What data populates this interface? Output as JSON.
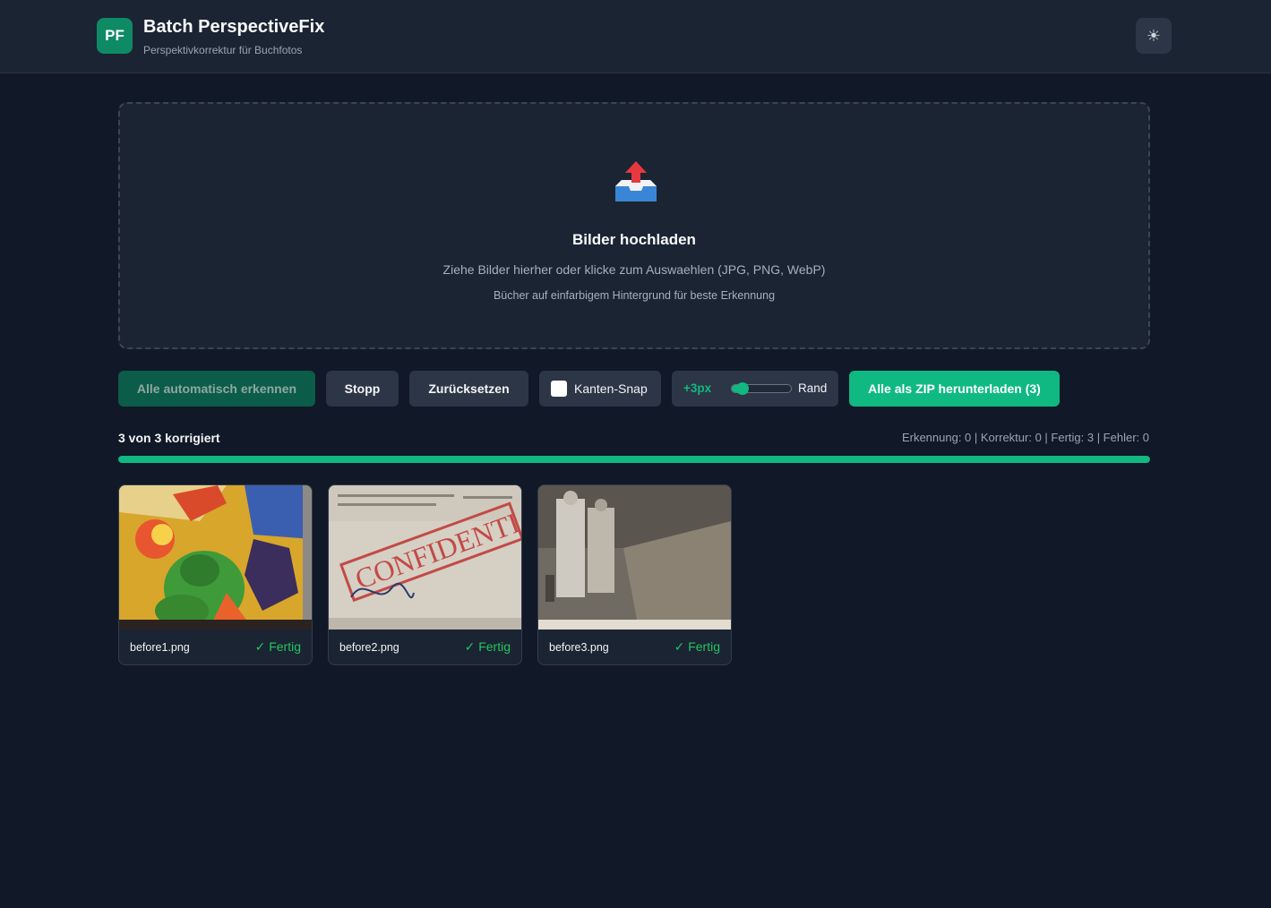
{
  "header": {
    "logo": "PF",
    "title": "Batch PerspectiveFix",
    "subtitle": "Perspektivkorrektur für Buchfotos",
    "theme_icon": "sun-icon",
    "theme_glyph": "☀"
  },
  "upload": {
    "icon": "inbox-upload-icon",
    "title": "Bilder hochladen",
    "hint": "Ziehe Bilder hierher oder klicke zum Auswaehlen (JPG, PNG, WebP)",
    "tip": "Bücher auf einfarbigem Hintergrund für beste Erkennung"
  },
  "toolbar": {
    "detect_label": "Alle automatisch erkennen",
    "stop_label": "Stopp",
    "reset_label": "Zurücksetzen",
    "snap_label": "Kanten-Snap",
    "snap_checked": false,
    "margin_value": "+3px",
    "margin_slider_fraction": 0.18,
    "margin_label": "Rand",
    "zip_label": "Alle als ZIP herunterladen (3)"
  },
  "progress": {
    "label": "3 von 3 korrigiert",
    "stats": "Erkennung: 0 | Korrektur: 0 | Fertig: 3 | Fehler: 0",
    "fraction": 1.0
  },
  "images": [
    {
      "filename": "before1.png",
      "status": "✓ Fertig",
      "thumb": "comic"
    },
    {
      "filename": "before2.png",
      "status": "✓ Fertig",
      "thumb": "document"
    },
    {
      "filename": "before3.png",
      "status": "✓ Fertig",
      "thumb": "photo"
    }
  ],
  "thumb_text": {
    "stamp": "CONFIDENTIAL"
  },
  "colors": {
    "accent": "#10b981",
    "background": "#111827",
    "surface": "#1b2433",
    "success": "#22c55e"
  }
}
